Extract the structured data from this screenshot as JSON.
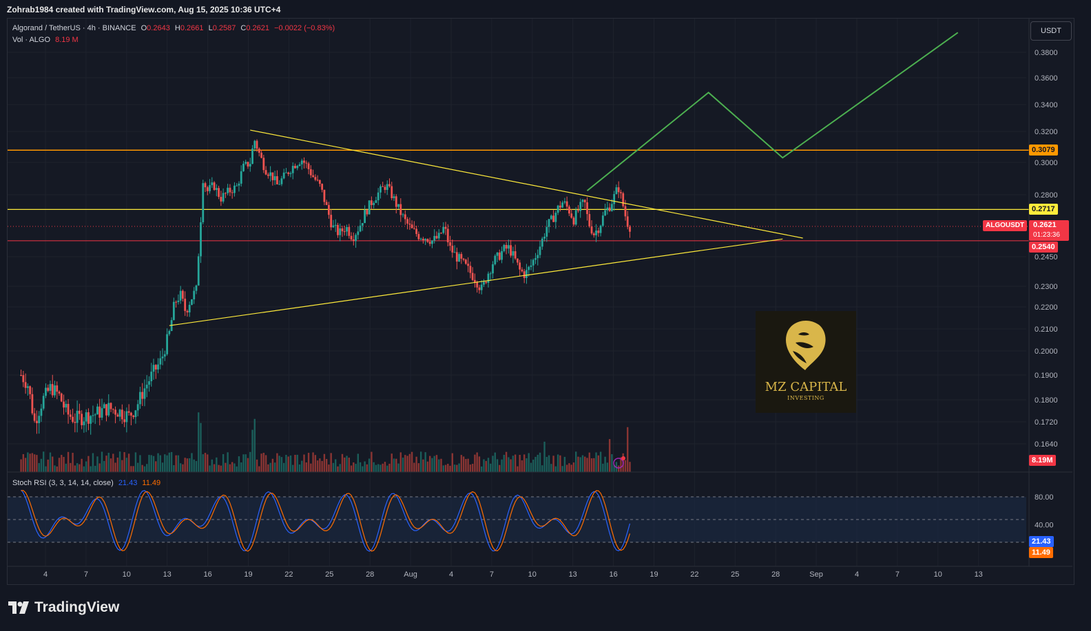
{
  "header": {
    "caption": "Zohrab1984 created with TradingView.com, Aug 15, 2025 10:36 UTC+4"
  },
  "legend": {
    "symbol": "Algorand / TetherUS · 4h · BINANCE",
    "o_label": "O",
    "o_val": "0.2643",
    "h_label": "H",
    "h_val": "0.2661",
    "l_label": "L",
    "l_val": "0.2587",
    "c_label": "C",
    "c_val": "0.2621",
    "change": "−0.0022 (−0.83%)",
    "vol_label": "Vol · ALGO",
    "vol_val": "8.19 M"
  },
  "currency_button": "USDT",
  "price_labels": {
    "resistance": "0.3079",
    "mid": "0.2717",
    "ticker": "ALGOUSDT",
    "last": "0.2621",
    "countdown": "01:23:36",
    "support": "0.2540",
    "volume": "8.19M"
  },
  "stoch": {
    "title": "Stoch RSI (3, 3, 14, 14, close)",
    "k_val": "21.43",
    "d_val": "11.49",
    "k_tag": "21.43",
    "d_tag": "11.49"
  },
  "logo": {
    "title": "MZ CAPITAL",
    "subtitle": "INVESTING"
  },
  "footer": {
    "brand": "TradingView"
  },
  "colors": {
    "up": "#26a69a",
    "down": "#ef5350",
    "orange": "#ff9800",
    "yellow": "#ffeb3b",
    "red_line": "#f23645",
    "green_path": "#4caf50",
    "stoch_k": "#2962ff",
    "stoch_d": "#ff6d00"
  },
  "chart_data": {
    "type": "candlestick",
    "symbol": "ALGOUSDT",
    "timeframe": "4h",
    "y_axis_ticks": [
      0.38,
      0.36,
      0.34,
      0.32,
      0.3,
      0.28,
      0.245,
      0.23,
      0.22,
      0.21,
      0.2,
      0.19,
      0.18,
      0.172,
      0.164
    ],
    "y_axis_tick_labels": [
      "0.3800",
      "0.3600",
      "0.3400",
      "0.3200",
      "0.3000",
      "0.2800",
      "0.2450",
      "0.2300",
      "0.2200",
      "0.2100",
      "0.2000",
      "0.1900",
      "0.1800",
      "0.1720",
      "0.1640"
    ],
    "x_axis_labels": [
      "4",
      "7",
      "10",
      "13",
      "16",
      "19",
      "22",
      "25",
      "28",
      "Aug",
      "4",
      "7",
      "10",
      "13",
      "16",
      "19",
      "22",
      "25",
      "28",
      "Sep",
      "4",
      "7",
      "10",
      "13"
    ],
    "ylim": [
      0.158,
      0.392
    ],
    "price_path": [
      [
        1.0,
        0.19
      ],
      [
        1.5,
        0.186
      ],
      [
        2.0,
        0.172
      ],
      [
        2.6,
        0.18
      ],
      [
        3.2,
        0.185
      ],
      [
        3.8,
        0.182
      ],
      [
        4.4,
        0.175
      ],
      [
        5.0,
        0.173
      ],
      [
        5.8,
        0.174
      ],
      [
        6.6,
        0.175
      ],
      [
        7.4,
        0.177
      ],
      [
        8.2,
        0.176
      ],
      [
        9.0,
        0.174
      ],
      [
        9.6,
        0.178
      ],
      [
        10.2,
        0.185
      ],
      [
        10.8,
        0.191
      ],
      [
        11.4,
        0.196
      ],
      [
        12.0,
        0.208
      ],
      [
        12.4,
        0.222
      ],
      [
        12.8,
        0.226
      ],
      [
        13.2,
        0.218
      ],
      [
        13.6,
        0.224
      ],
      [
        14.0,
        0.228
      ],
      [
        14.3,
        0.262
      ],
      [
        14.5,
        0.29
      ],
      [
        14.8,
        0.282
      ],
      [
        15.3,
        0.286
      ],
      [
        15.8,
        0.278
      ],
      [
        16.4,
        0.282
      ],
      [
        17.0,
        0.285
      ],
      [
        17.5,
        0.297
      ],
      [
        18.0,
        0.3
      ],
      [
        18.3,
        0.315
      ],
      [
        18.7,
        0.305
      ],
      [
        19.1,
        0.296
      ],
      [
        19.6,
        0.292
      ],
      [
        20.0,
        0.286
      ],
      [
        20.6,
        0.292
      ],
      [
        21.2,
        0.298
      ],
      [
        21.8,
        0.302
      ],
      [
        22.2,
        0.298
      ],
      [
        22.6,
        0.292
      ],
      [
        23.2,
        0.285
      ],
      [
        23.7,
        0.272
      ],
      [
        24.1,
        0.262
      ],
      [
        24.6,
        0.258
      ],
      [
        25.1,
        0.262
      ],
      [
        25.6,
        0.256
      ],
      [
        26.1,
        0.262
      ],
      [
        26.6,
        0.271
      ],
      [
        27.1,
        0.277
      ],
      [
        27.6,
        0.282
      ],
      [
        28.1,
        0.286
      ],
      [
        28.5,
        0.28
      ],
      [
        29.0,
        0.272
      ],
      [
        29.5,
        0.265
      ],
      [
        30.0,
        0.26
      ],
      [
        30.5,
        0.257
      ],
      [
        31.0,
        0.256
      ],
      [
        31.5,
        0.254
      ],
      [
        32.0,
        0.256
      ],
      [
        32.4,
        0.262
      ],
      [
        32.8,
        0.25
      ],
      [
        33.2,
        0.246
      ],
      [
        33.7,
        0.242
      ],
      [
        34.2,
        0.238
      ],
      [
        34.7,
        0.234
      ],
      [
        35.2,
        0.228
      ],
      [
        35.6,
        0.236
      ],
      [
        36.0,
        0.242
      ],
      [
        36.4,
        0.245
      ],
      [
        36.8,
        0.249
      ],
      [
        37.2,
        0.25
      ],
      [
        37.6,
        0.244
      ],
      [
        38.0,
        0.238
      ],
      [
        38.4,
        0.236
      ],
      [
        38.8,
        0.24
      ],
      [
        39.2,
        0.246
      ],
      [
        39.6,
        0.253
      ],
      [
        40.0,
        0.262
      ],
      [
        40.4,
        0.266
      ],
      [
        40.8,
        0.272
      ],
      [
        41.2,
        0.276
      ],
      [
        41.6,
        0.272
      ],
      [
        42.0,
        0.266
      ],
      [
        42.4,
        0.272
      ],
      [
        42.8,
        0.276
      ],
      [
        43.1,
        0.264
      ],
      [
        43.5,
        0.258
      ],
      [
        43.9,
        0.262
      ],
      [
        44.3,
        0.27
      ],
      [
        44.7,
        0.274
      ],
      [
        45.0,
        0.279
      ],
      [
        45.3,
        0.285
      ],
      [
        45.6,
        0.276
      ],
      [
        45.9,
        0.266
      ],
      [
        46.1,
        0.262
      ]
    ],
    "volume_spikes": [
      {
        "x": 14.2,
        "v": 70
      },
      {
        "x": 14.4,
        "v": 48
      },
      {
        "x": 18.1,
        "v": 42
      },
      {
        "x": 18.4,
        "v": 38
      },
      {
        "x": 39.8,
        "v": 30
      },
      {
        "x": 44.6,
        "v": 20
      },
      {
        "x": 46.0,
        "v": 32
      }
    ],
    "annotations": {
      "resistance_level": 0.3079,
      "mid_level": 0.2717,
      "support_level": 0.254,
      "triangle_upper": [
        [
          18.0,
          0.321
        ],
        [
          59.0,
          0.2555
        ]
      ],
      "triangle_lower": [
        [
          12.0,
          0.2115
        ],
        [
          57.5,
          0.255
        ]
      ],
      "projection": [
        [
          43.0,
          0.2825
        ],
        [
          52.0,
          0.349
        ],
        [
          57.5,
          0.303
        ],
        [
          70.5,
          0.3955
        ]
      ]
    },
    "stoch_rsi": {
      "params": "3, 3, 14, 14, close",
      "k_last": 21.43,
      "d_last": 11.49,
      "bands": [
        80,
        50,
        20
      ],
      "band_labels": [
        "80.00",
        "40.00"
      ],
      "cycle_peaks": [
        1.0,
        6.0,
        9.8,
        13.4,
        17.3,
        20.6,
        25.5,
        27.6,
        31.2,
        34.6,
        38.6,
        41.3,
        45.1
      ]
    }
  }
}
